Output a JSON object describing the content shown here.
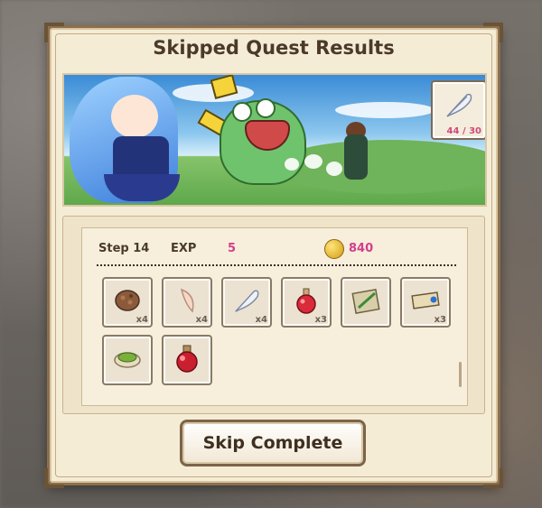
{
  "dialog": {
    "title": "Skipped Quest Results"
  },
  "banner": {
    "feather_count": "44 / 30"
  },
  "stats": {
    "step_label": "Step 14",
    "exp_label": "EXP",
    "exp_value": "5",
    "gold_value": "840"
  },
  "items": [
    {
      "icon": "meat-chunk-icon",
      "qty": "x4"
    },
    {
      "icon": "fang-icon",
      "qty": "x4"
    },
    {
      "icon": "feather-icon",
      "qty": "x4"
    },
    {
      "icon": "red-potion-icon",
      "qty": "x3"
    },
    {
      "icon": "scroll-quill-icon",
      "qty": ""
    },
    {
      "icon": "ticket-icon",
      "qty": "x3"
    },
    {
      "icon": "herb-plate-icon",
      "qty": ""
    },
    {
      "icon": "large-red-potion-icon",
      "qty": ""
    }
  ],
  "buttons": {
    "skip_complete": "Skip Complete"
  },
  "colors": {
    "accent_pink": "#d23f8a",
    "frame_brown": "#8b6f4e",
    "parchment": "#f5ecd6"
  }
}
